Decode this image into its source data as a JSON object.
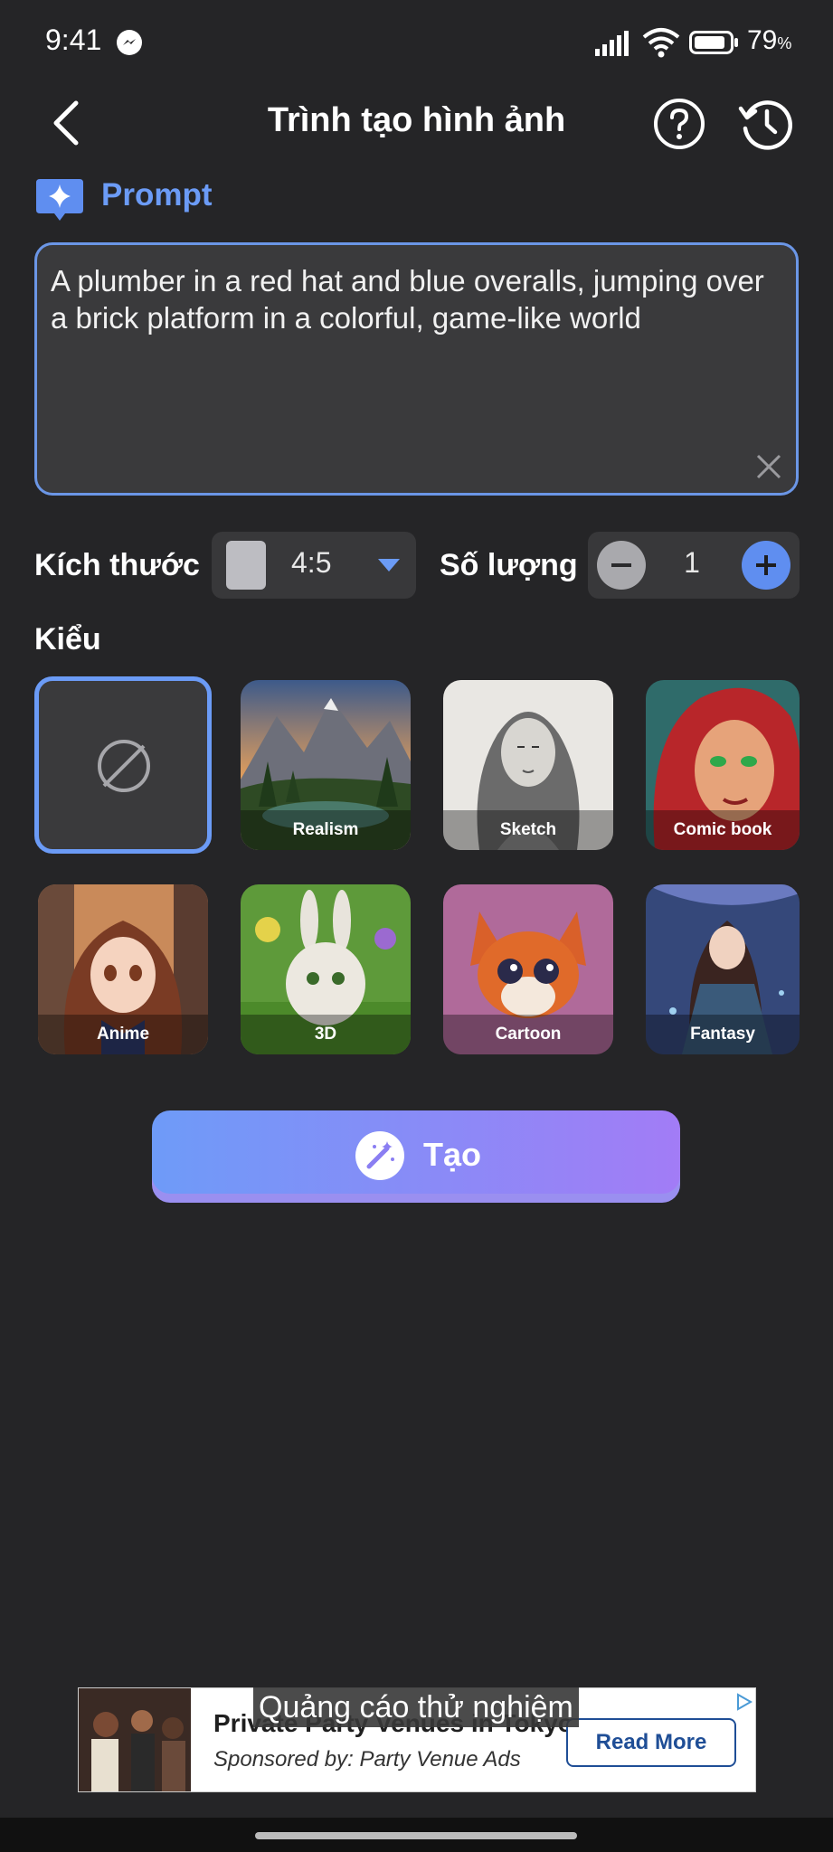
{
  "status_bar": {
    "time": "9:41",
    "battery_value": "79",
    "battery_unit": "%"
  },
  "header": {
    "title": "Trình tạo hình ảnh"
  },
  "prompt": {
    "label": "Prompt",
    "text": "A plumber in a red hat and blue overalls, jumping over a brick platform in a colorful, game-like world"
  },
  "options": {
    "size_label": "Kích thước",
    "size_value": "4:5",
    "quantity_label": "Số lượng",
    "quantity_value": "1"
  },
  "styles": {
    "label": "Kiểu",
    "items": [
      {
        "label": "",
        "selected": true
      },
      {
        "label": "Realism"
      },
      {
        "label": "Sketch"
      },
      {
        "label": "Comic book"
      },
      {
        "label": "Anime"
      },
      {
        "label": "3D"
      },
      {
        "label": "Cartoon"
      },
      {
        "label": "Fantasy"
      }
    ]
  },
  "generate": {
    "label": "Tạo"
  },
  "ad": {
    "overlay": "Quảng cáo thử nghiệm",
    "title": "Private Party Venues in Tokyo",
    "sponsor": "Sponsored by: Party Venue Ads",
    "cta": "Read More"
  },
  "colors": {
    "accent": "#6b9bf6",
    "background": "#252527",
    "gradient_start": "#6e9bf8",
    "gradient_end": "#a27cf6"
  }
}
